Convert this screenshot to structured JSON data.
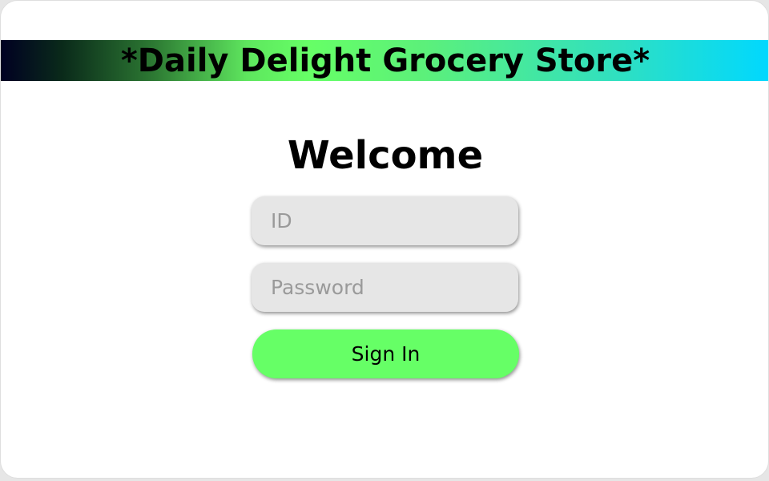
{
  "header": {
    "title": "*Daily Delight Grocery Store*",
    "gradient_colors": [
      "#000022",
      "#66ff66",
      "#00d8ff"
    ]
  },
  "login": {
    "heading": "Welcome",
    "id_placeholder": "ID",
    "id_value": "",
    "password_placeholder": "Password",
    "password_value": "",
    "submit_label": "Sign In",
    "submit_color": "#66ff66"
  }
}
